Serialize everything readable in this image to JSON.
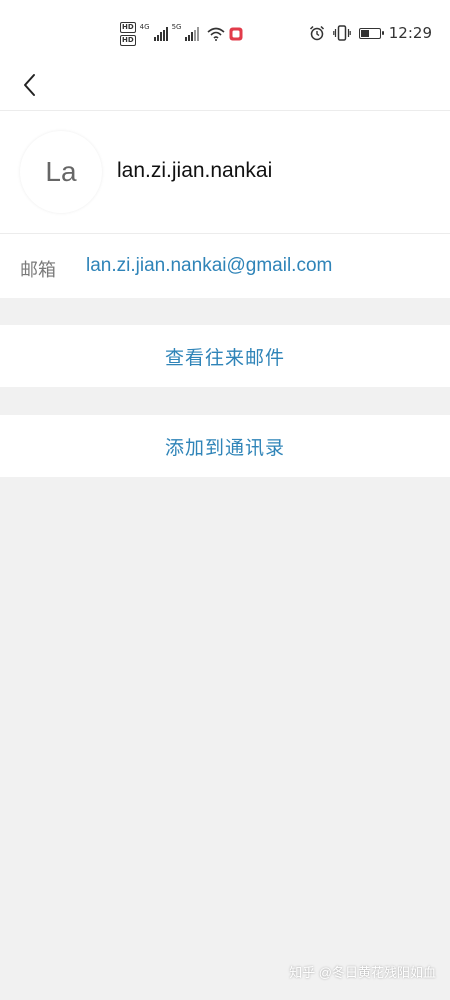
{
  "status_bar": {
    "hd_badges": [
      "HD",
      "HD"
    ],
    "net_primary": "4G",
    "net_secondary": "5G",
    "time": "12:29",
    "battery_level": 0.5,
    "icons": [
      "wifi-icon",
      "notification-icon",
      "alarm-icon",
      "vibrate-icon",
      "battery-icon"
    ]
  },
  "header": {
    "back_icon": "chevron-left-icon"
  },
  "contact": {
    "avatar_initials": "La",
    "name": "lan.zi.jian.nankai",
    "email_label": "邮箱",
    "email": "lan.zi.jian.nankai@gmail.com"
  },
  "actions": {
    "view_history": "查看往来邮件",
    "add_to_contacts": "添加到通讯录"
  },
  "watermark": "知乎 @冬日黄花残阳如血",
  "colors": {
    "accent": "#2f84b8",
    "background": "#f1f1f1",
    "card": "#ffffff"
  }
}
